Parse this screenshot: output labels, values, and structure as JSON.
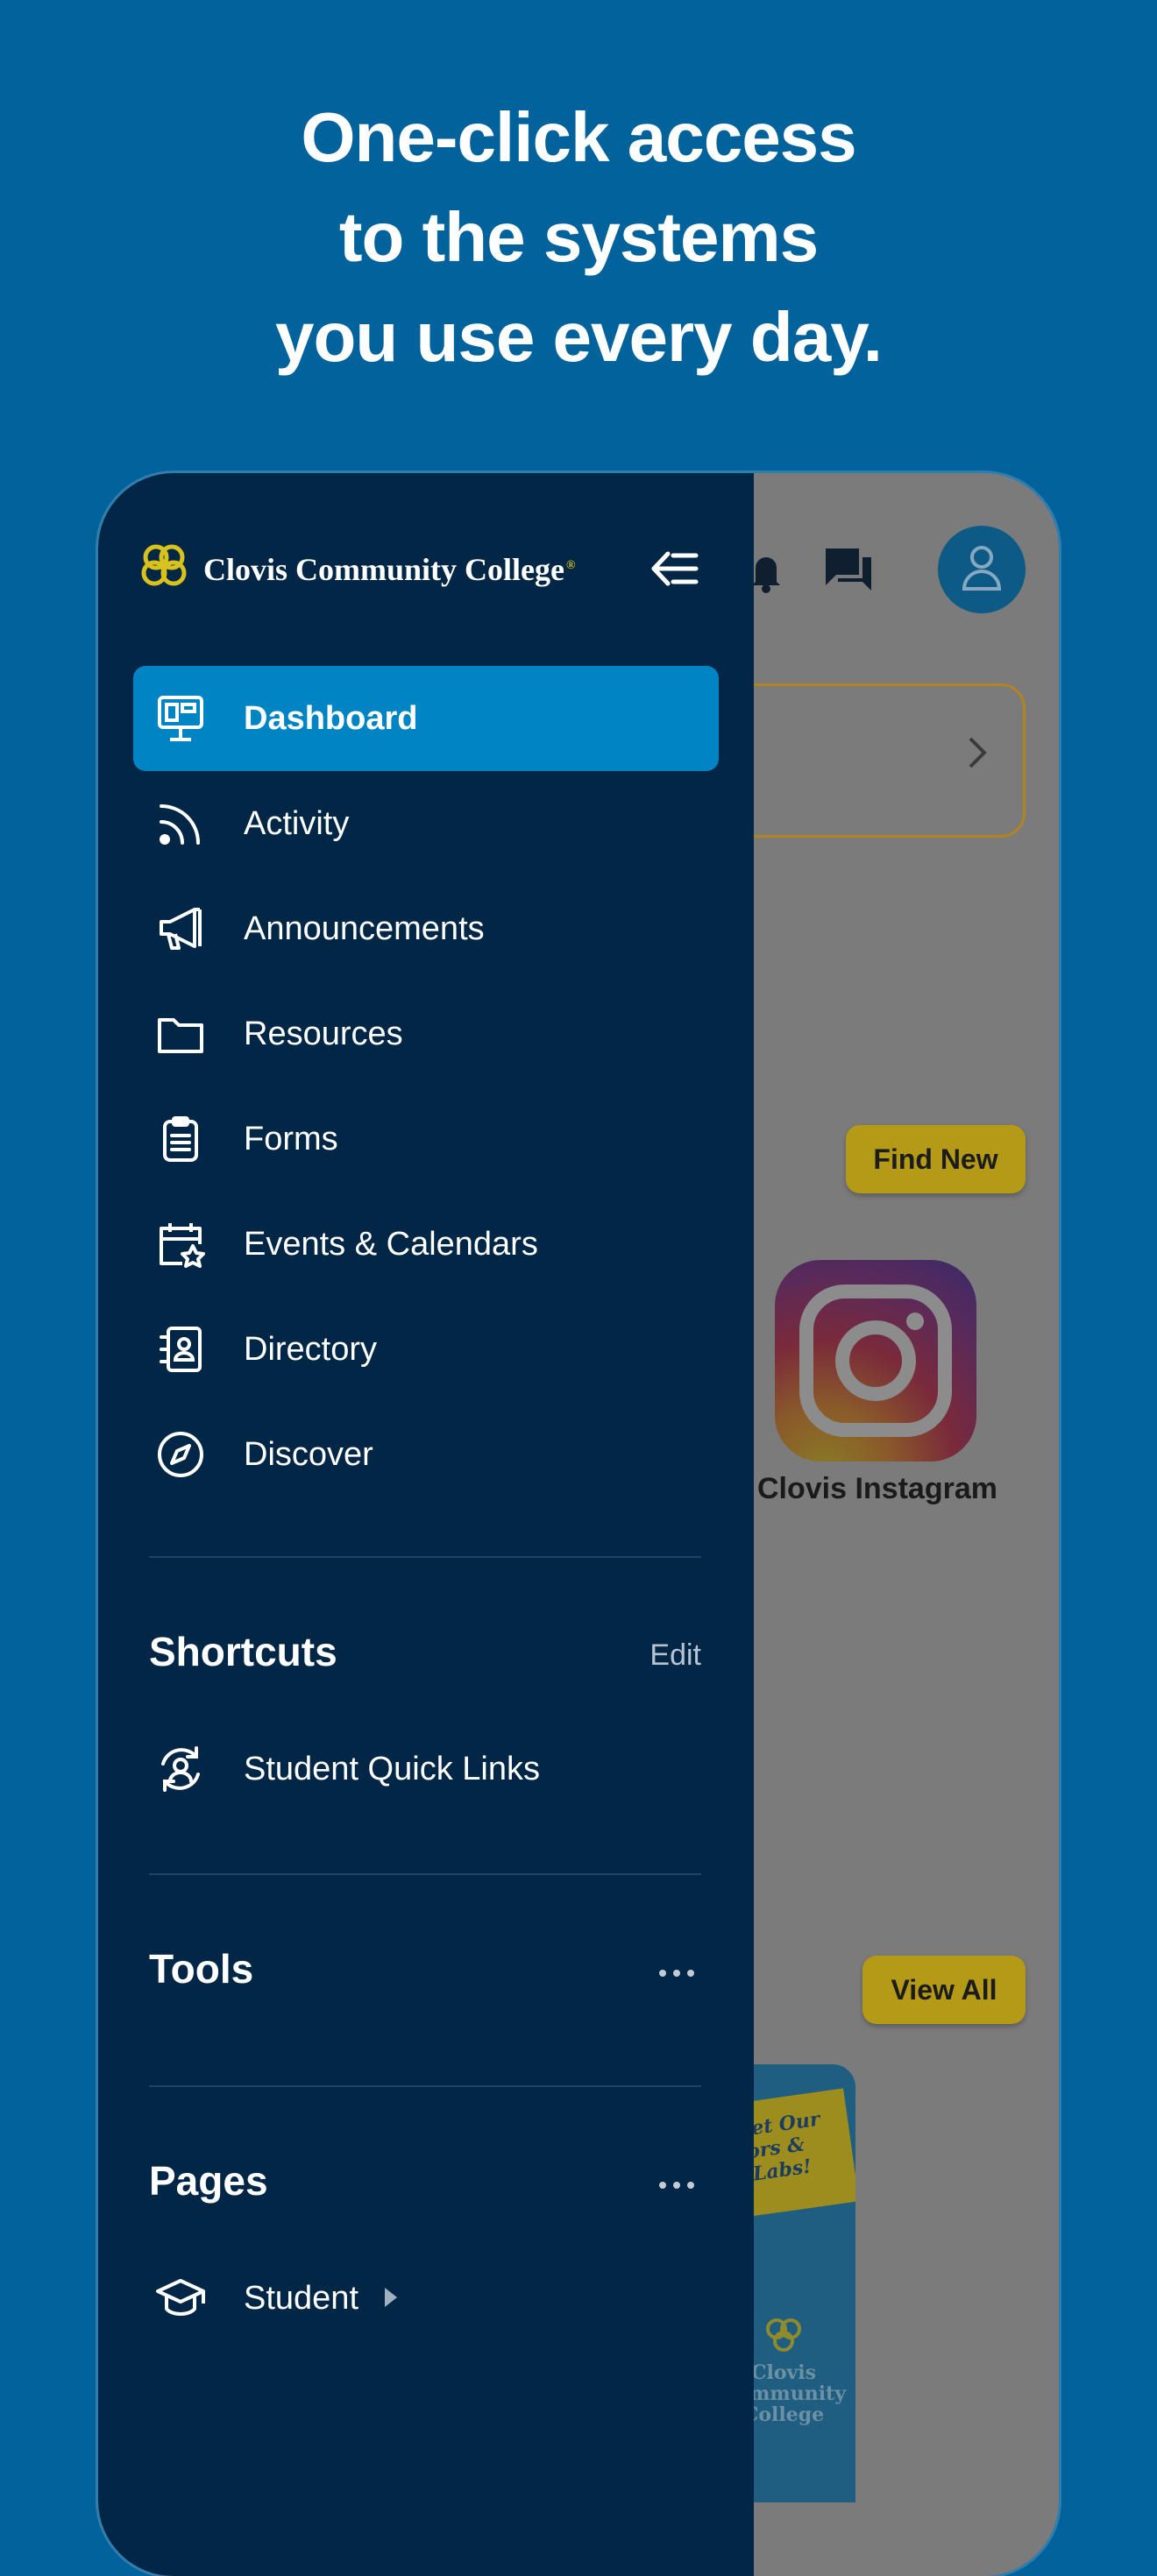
{
  "headline": {
    "line1": "One-click access",
    "line2": "to the systems",
    "line3": "you use every day."
  },
  "background_app": {
    "find_new_label": "Find New",
    "instagram_label": "Clovis Instagram",
    "view_all_label": "View All",
    "promo_banner_text": "e Meet Our ructors & Our Labs!",
    "promo_college_text": "Clovis Community College"
  },
  "drawer": {
    "brand_name": "Clovis Community College",
    "brand_mark": "®",
    "nav_items": [
      {
        "label": "Dashboard",
        "icon": "dashboard-icon",
        "active": true
      },
      {
        "label": "Activity",
        "icon": "rss-icon"
      },
      {
        "label": "Announcements",
        "icon": "megaphone-icon"
      },
      {
        "label": "Resources",
        "icon": "folder-icon"
      },
      {
        "label": "Forms",
        "icon": "clipboard-icon"
      },
      {
        "label": "Events & Calendars",
        "icon": "calendar-star-icon"
      },
      {
        "label": "Directory",
        "icon": "contact-book-icon"
      },
      {
        "label": "Discover",
        "icon": "compass-icon"
      }
    ],
    "shortcuts": {
      "title": "Shortcuts",
      "edit_label": "Edit",
      "items": [
        {
          "label": "Student Quick Links",
          "icon": "user-sync-icon"
        }
      ]
    },
    "tools": {
      "title": "Tools"
    },
    "pages": {
      "title": "Pages",
      "items": [
        {
          "label": "Student",
          "icon": "graduation-cap-icon"
        }
      ]
    }
  },
  "colors": {
    "page_background": "#02629b",
    "drawer_background": "#022646",
    "active_item": "#0184c3",
    "accent_gold": "#d8c21e",
    "overlay_grey": "#7b7b7b"
  }
}
